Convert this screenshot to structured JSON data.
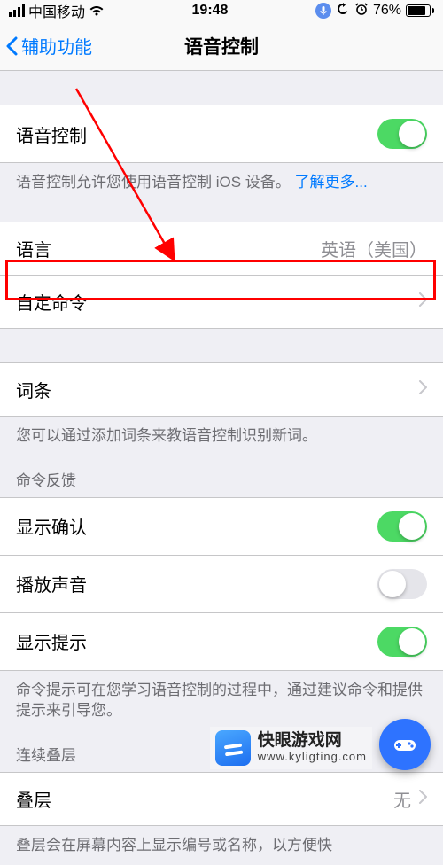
{
  "status": {
    "carrier": "中国移动",
    "time": "19:48",
    "battery_pct": "76%"
  },
  "nav": {
    "back": "辅助功能",
    "title": "语音控制"
  },
  "voiceControl": {
    "label": "语音控制",
    "on": true,
    "footer_prefix": "语音控制允许您使用语音控制 iOS 设备。",
    "learn_more": "了解更多..."
  },
  "language": {
    "label": "语言",
    "value": "英语（美国）"
  },
  "customCommands": {
    "label": "自定命令"
  },
  "vocabulary": {
    "label": "词条",
    "footer": "您可以通过添加词条来教语音控制识别新词。"
  },
  "feedbackHeader": "命令反馈",
  "showConfirm": {
    "label": "显示确认",
    "on": true
  },
  "playSound": {
    "label": "播放声音",
    "on": false
  },
  "showHints": {
    "label": "显示提示",
    "on": true,
    "footer": "命令提示可在您学习语音控制的过程中，通过建议命令和提供提示来引导您。"
  },
  "overlayHeader": "连续叠层",
  "overlay": {
    "label": "叠层",
    "value": "无",
    "footer_partial": "叠层会在屏幕内容上显示编号或名称，以方便快"
  },
  "watermark": {
    "name": "快眼游戏网",
    "url": "www.kyligting.com"
  }
}
